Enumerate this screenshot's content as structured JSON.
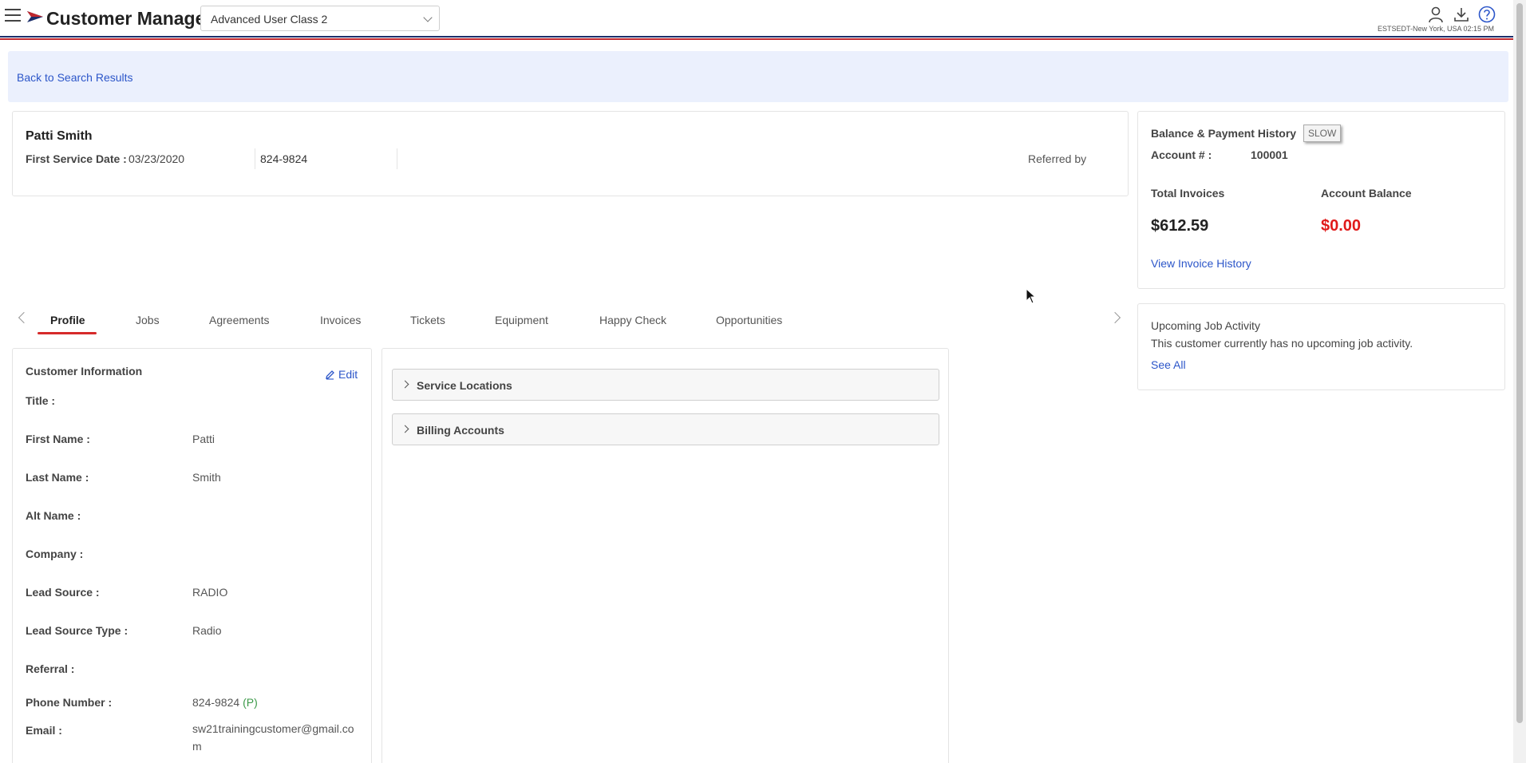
{
  "header": {
    "app_title": "Customer Manager",
    "role_selected": "Advanced User Class 2",
    "timezone": "ESTSEDT-New York, USA 02:15 PM",
    "icons": [
      "menu-icon",
      "user-icon",
      "download-icon",
      "help-icon"
    ]
  },
  "back_link": "Back to Search Results",
  "customer": {
    "name": "Patti Smith",
    "first_service_date_label": "First Service Date :",
    "first_service_date": "03/23/2020",
    "phone": "824-9824",
    "referred_by_label": "Referred by"
  },
  "balance": {
    "title": "Balance & Payment History",
    "badge": "SLOW",
    "account_label": "Account # :",
    "account_number": "100001",
    "total_invoices_label": "Total Invoices",
    "total_invoices": "$612.59",
    "account_balance_label": "Account Balance",
    "account_balance": "$0.00",
    "view_history_link": "View Invoice History"
  },
  "upcoming": {
    "title": "Upcoming Job Activity",
    "message": "This customer currently has no upcoming job activity.",
    "see_all": "See All"
  },
  "tabs": [
    "Profile",
    "Jobs",
    "Agreements",
    "Invoices",
    "Tickets",
    "Equipment",
    "Happy Check",
    "Opportunities"
  ],
  "active_tab": "Profile",
  "customer_info": {
    "title": "Customer Information",
    "edit_label": "Edit",
    "rows": [
      {
        "label": "Title :",
        "value": ""
      },
      {
        "label": "First Name :",
        "value": "Patti"
      },
      {
        "label": "Last Name :",
        "value": "Smith"
      },
      {
        "label": "Alt Name :",
        "value": ""
      },
      {
        "label": "Company :",
        "value": ""
      },
      {
        "label": "Lead Source :",
        "value": "RADIO"
      },
      {
        "label": "Lead Source Type :",
        "value": "Radio"
      },
      {
        "label": "Referral :",
        "value": ""
      },
      {
        "label": "Phone Number :",
        "value": "824-9824"
      },
      {
        "label": "Email :",
        "value": "sw21trainingcustomer@gmail.com"
      }
    ],
    "phone_tag": "(P)"
  },
  "accordions": [
    "Service Locations",
    "Billing Accounts"
  ],
  "colors": {
    "accent_red": "#d62a2a",
    "link_blue": "#2c56c9",
    "balance_red": "#e01a1a",
    "banner_bg": "#ebf0fd"
  }
}
